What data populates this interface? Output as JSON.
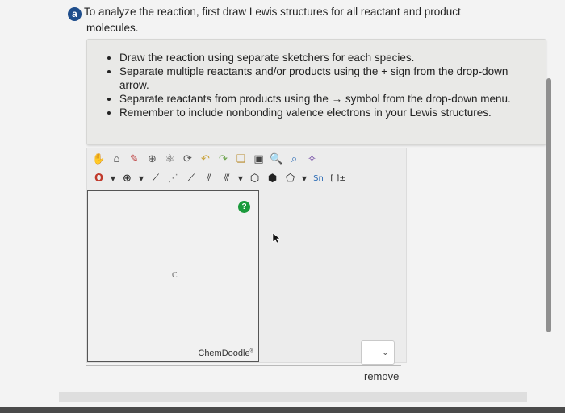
{
  "question": {
    "badge": "a",
    "line1": "To analyze the reaction, first draw Lewis structures for all reactant and product",
    "line2": "molecules."
  },
  "instructions": [
    "Draw the reaction using separate sketchers for each species.",
    "Separate multiple reactants and/or products using the + sign from the drop-down arrow.",
    "Separate reactants from products using the → symbol from the drop-down menu.",
    "Remember to include nonbonding valence electrons in your Lewis structures."
  ],
  "toolbar": {
    "row1": [
      "hand-icon",
      "eraser-icon",
      "pencil-icon",
      "plus-circle-icon",
      "ring-template-icon",
      "undo-icon",
      "redo-icon",
      "copy-icon",
      "paste-icon",
      "zoom-in-icon",
      "zoom-out-icon",
      "clean-icon"
    ],
    "row2_labels": {
      "atom": "O",
      "charge": "⊕",
      "brackets": "[ ]±",
      "sn": "Sn"
    }
  },
  "canvas": {
    "atom_label": "C",
    "brand": "ChemDoodle",
    "brand_mark": "®",
    "help": "?"
  },
  "remove_label": "remove",
  "colors": {
    "badge": "#1f4e8c",
    "help": "#1b9a3c"
  }
}
